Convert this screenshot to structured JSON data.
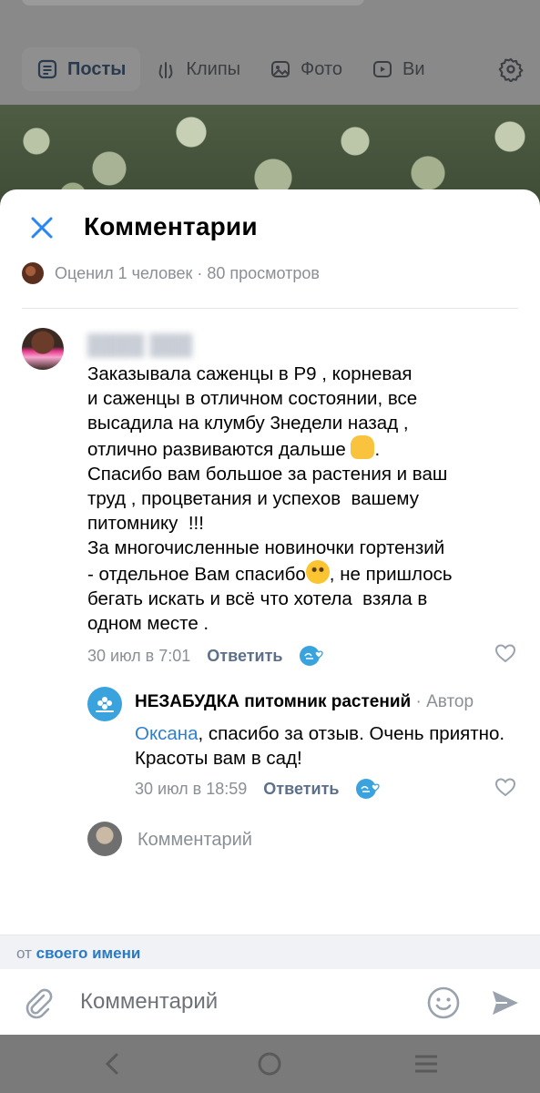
{
  "background": {
    "tabs": [
      {
        "label": "Посты",
        "icon": "posts-icon",
        "active": true
      },
      {
        "label": "Клипы",
        "icon": "clips-icon",
        "active": false
      },
      {
        "label": "Фото",
        "icon": "photo-icon",
        "active": false
      },
      {
        "label": "Ви",
        "icon": "video-icon",
        "active": false
      }
    ],
    "settings_icon": "gear-icon"
  },
  "sheet": {
    "title": "Комментарии",
    "stats": "Оценил 1 человек · 80 просмотров",
    "comment": {
      "text_1": "Заказывала саженцы в Р9 , корневая\nи саженцы в отличном состоянии, все\nвысадила на клумбу 3недели назад ,\nотлично развиваются дальше ",
      "text_2": ".\nСпасибо вам большое за растения и ваш\nтруд , процветания и успехов  вашему\nпитомнику  !!!\nЗа многочисленные новиночки гортензий\n- отдельное Вам спасибо",
      "text_3": ", не пришлось\nбегать искать и всё что хотела  взяла в\nодном месте .",
      "date": "30 июл в 7:01",
      "reply_label": "Ответить"
    },
    "reply": {
      "author": "НЕЗАБУДКА питомник растений",
      "role": "· Автор",
      "mention": "Оксана",
      "text": ", спасибо за отзыв. Очень приятно. Красоты вам в сад!",
      "date": "30 июл в 18:59",
      "reply_label": "Ответить"
    },
    "new_comment_placeholder": "Комментарий",
    "from_prefix": "от",
    "from_link": "своего имени",
    "input_placeholder": "Комментарий"
  },
  "colors": {
    "accent": "#2a79c7",
    "mention": "#2f7fd0",
    "muted_text": "#8a8f96",
    "overlay": "#7a7a7a"
  }
}
